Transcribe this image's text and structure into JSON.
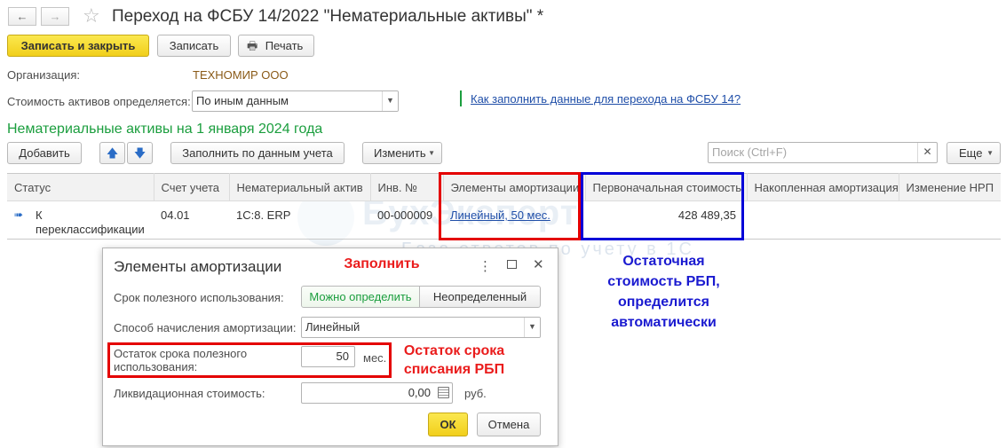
{
  "window": {
    "title": "Переход на ФСБУ 14/2022 \"Нематериальные активы\" *"
  },
  "toolbar": {
    "save_close": "Записать и закрыть",
    "save": "Записать",
    "print": "Печать"
  },
  "form": {
    "org_label": "Организация:",
    "org_value": "ТЕХНОМИР ООО",
    "cost_label": "Стоимость активов определяется:",
    "cost_value": "По иным данным",
    "help_link": "Как заполнить данные для перехода на ФСБУ 14?"
  },
  "section": {
    "title": "Нематериальные активы на 1 января 2024 года",
    "add": "Добавить",
    "fill": "Заполнить по данным учета",
    "change": "Изменить",
    "search_placeholder": "Поиск (Ctrl+F)",
    "more": "Еще"
  },
  "table": {
    "columns": [
      "Статус",
      "Счет учета",
      "Нематериальный актив",
      "Инв. №",
      "Элементы амортизации",
      "Первоначальная стоимость",
      "Накопленная амортизация",
      "Изменение НРП"
    ],
    "rows": [
      {
        "status_1": "К",
        "status_2": "переклассификации",
        "account": "04.01",
        "asset": "1С:8. ERP",
        "inv": "00-000009",
        "amort": "Линейный, 50 мес.",
        "cost": "428 489,35",
        "accum": "",
        "nrp": ""
      }
    ]
  },
  "watermark": {
    "brand": "БухЭксперт",
    "tagline": "База ответов по учету в 1С"
  },
  "dialog": {
    "title": "Элементы амортизации",
    "life_label": "Срок полезного использования:",
    "life_opt1": "Можно определить",
    "life_opt2": "Неопределенный",
    "method_label": "Способ начисления амортизации:",
    "method_value": "Линейный",
    "remain_label_1": "Остаток срока полезного",
    "remain_label_2": "использования:",
    "remain_value": "50",
    "remain_unit": "мес.",
    "liq_label": "Ликвидационная стоимость:",
    "liq_value": "0,00",
    "liq_unit": "руб.",
    "ok": "ОК",
    "cancel": "Отмена"
  },
  "annotations": {
    "fill": "Заполнить",
    "remain_1": "Остаток срока",
    "remain_2": "списания РБП",
    "blue_1": "Остаточная",
    "blue_2": "стоимость РБП,",
    "blue_3": "определится",
    "blue_4": "автоматически"
  },
  "colors": {
    "accent_green": "#1b9e3e",
    "link_blue": "#1f4ea8",
    "annotation_red": "#ea1c1c",
    "annotation_blue": "#1a1ad0",
    "primary_button": "#f5d21f"
  }
}
